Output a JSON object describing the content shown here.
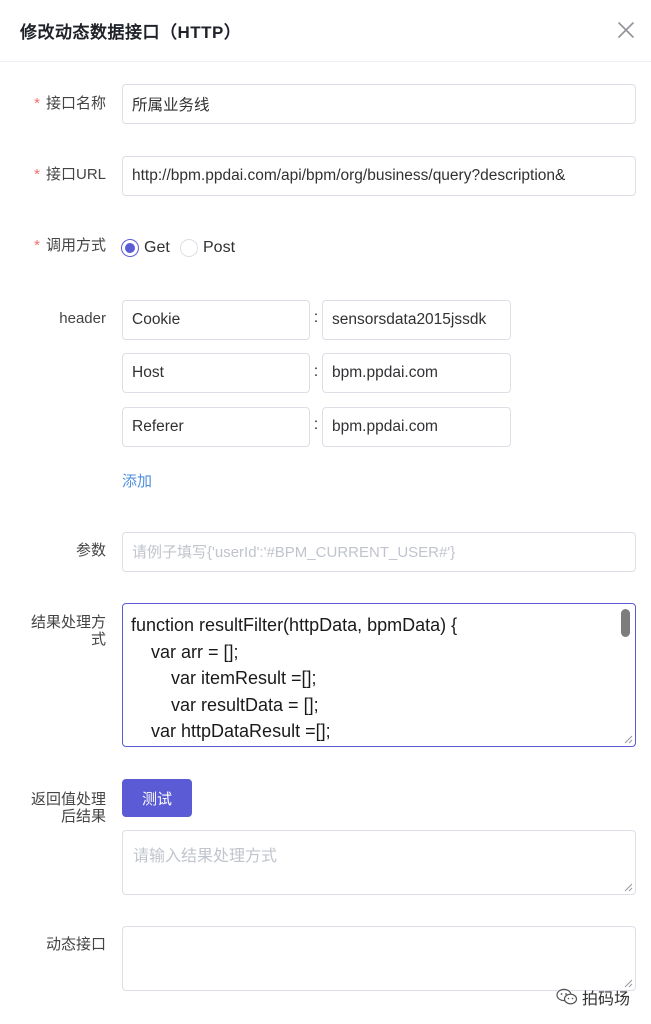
{
  "dialog": {
    "title": "修改动态数据接口（HTTP）"
  },
  "form": {
    "interface_name": {
      "label": "接口名称",
      "required": "*",
      "value": "所属业务线"
    },
    "interface_url": {
      "label": "接口URL",
      "required": "*",
      "value": "http://bpm.ppdai.com/api/bpm/org/business/query?description&"
    },
    "call_method": {
      "label": "调用方式",
      "required": "*",
      "options": [
        {
          "label": "Get",
          "checked": true
        },
        {
          "label": "Post",
          "checked": false
        }
      ]
    },
    "header": {
      "label": "header",
      "separator": ":",
      "rows": [
        {
          "key": "Cookie",
          "value": "sensorsdata2015jssdk"
        },
        {
          "key": "Host",
          "value": "bpm.ppdai.com"
        },
        {
          "key": "Referer",
          "value": "bpm.ppdai.com"
        }
      ],
      "add_label": "添加"
    },
    "params": {
      "label": "参数",
      "placeholder": "请例子填写{'userId':'#BPM_CURRENT_USER#'}"
    },
    "result_handler": {
      "label_line1": "结果处理方",
      "label_line2": "式",
      "code_lines": [
        "function resultFilter(httpData, bpmData) {",
        "    var arr = [];",
        "        var itemResult =[];",
        "        var resultData = [];",
        "    var httpDataResult =[];"
      ]
    },
    "return_result": {
      "label_line1": "返回值处理",
      "label_line2": "后结果",
      "test_button": "测试",
      "placeholder": "请输入结果处理方式"
    },
    "dynamic_interface": {
      "label": "动态接口",
      "value": ""
    }
  },
  "watermark": {
    "text": "拍码场"
  },
  "colors": {
    "accent": "#5b5bd6",
    "required": "#f56c6c",
    "link": "#4f8fe0",
    "border": "#dcdfe6"
  }
}
